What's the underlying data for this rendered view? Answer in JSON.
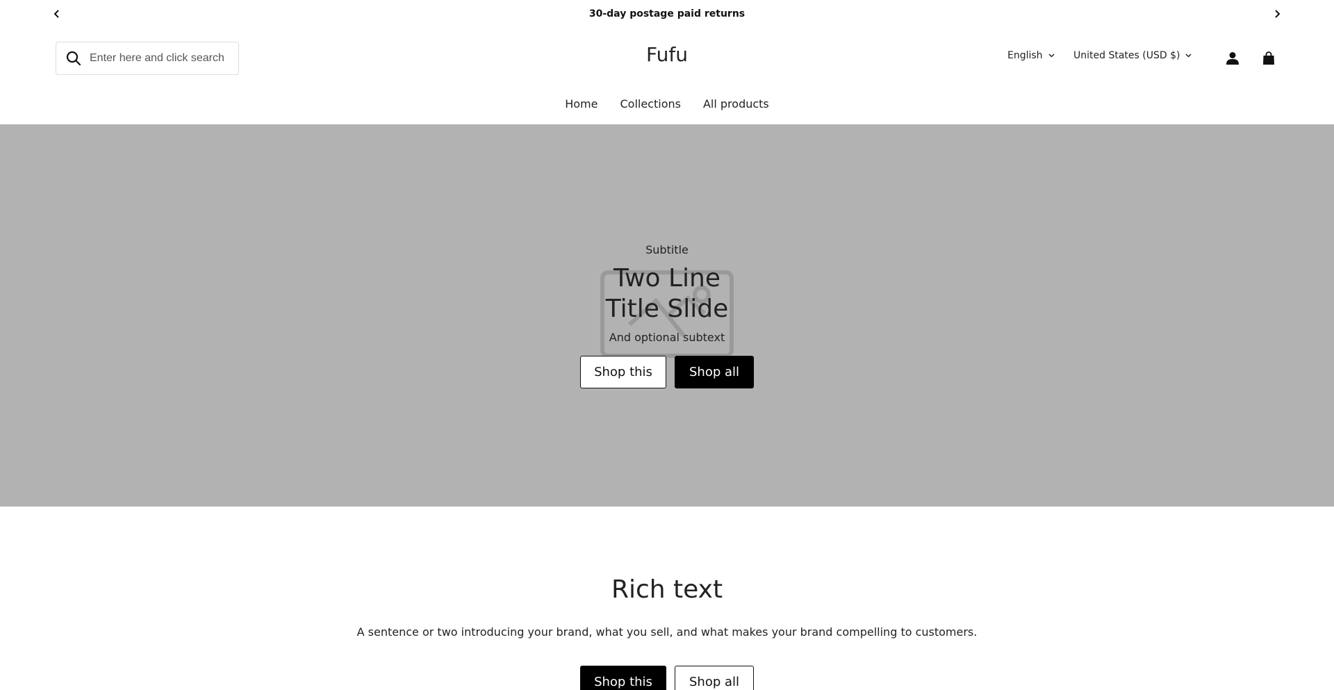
{
  "announcement": {
    "text": "30-day postage paid returns",
    "prev_icon": "chevron-left-icon",
    "next_icon": "chevron-right-icon"
  },
  "header": {
    "search_placeholder": "Enter here and click search",
    "logo": "Fufu",
    "language": "English",
    "currency": "United States (USD $)",
    "account_icon": "user-icon",
    "cart_icon": "shopping-bag-icon"
  },
  "nav": {
    "items": [
      "Home",
      "Collections",
      "All products"
    ]
  },
  "hero": {
    "subtitle": "Subtitle",
    "title_line1": "Two Line",
    "title_line2": "Title Slide",
    "subtext": "And optional subtext",
    "button_primary": "Shop this",
    "button_secondary": "Shop all",
    "background_color": "#b2b2b2"
  },
  "rich_text": {
    "title": "Rich text",
    "description": "A sentence or two introducing your brand, what you sell, and what makes your brand compelling to customers.",
    "button_primary": "Shop this",
    "button_secondary": "Shop all"
  }
}
